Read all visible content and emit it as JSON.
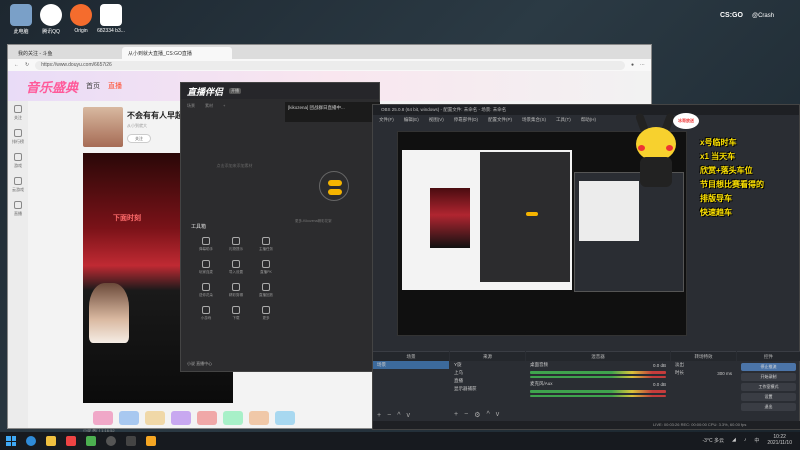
{
  "desktop": {
    "icons": [
      {
        "label": "此电脑",
        "color": "#7aa0c8"
      },
      {
        "label": "腾讯QQ",
        "color": "#ffffff"
      },
      {
        "label": "Origin",
        "color": "#f56c2d"
      },
      {
        "label": "682334 b3...",
        "color": "#ffffff"
      }
    ],
    "csgo_logo": "CS:GO",
    "weibo_handle": "@Crash"
  },
  "browser": {
    "tabs": [
      {
        "label": "我的关注 - 斗鱼",
        "active": false
      },
      {
        "label": "从小到就大直播_CS:GO直播",
        "active": true
      }
    ],
    "url": "https://www.douyu.com/6657i26",
    "site_logo": "音乐盛典",
    "nav": [
      "首页",
      "直播"
    ],
    "room_title": "不会有有人早起",
    "room_sub": "从小到就大",
    "follow_label": "关注",
    "video_caption": "下面时刻",
    "sidebar": [
      "关注",
      "排行榜",
      "游戏",
      "云游戏",
      "直播",
      "视频"
    ],
    "bottom_text": "小说 热门 1:16:52"
  },
  "castapp": {
    "brand": "直播伴侣",
    "version": "开播",
    "tabs": [
      "场景",
      "素材",
      "+"
    ],
    "empty_hint": "点击添加来添加素材",
    "toolbox_title": "工具箱",
    "tools": [
      "弹幕助手",
      "礼物提示",
      "主播任务",
      "玩家连麦",
      "导入设置",
      "直播PK",
      "送你花朵",
      "精彩剪辑",
      "直播回放",
      "小游戏",
      "下载",
      "更多"
    ],
    "hint": "更多-Kikozena精彩花絮",
    "footer": "小说 直播中心",
    "chat_title": "[kikozena] 团战群日直播中..."
  },
  "obs": {
    "title": "OBS 25.0.8 (64 bit, windows) - 配置文件: 未命名 - 场景: 未命名",
    "menu": [
      "文件(F)",
      "编辑(E)",
      "视图(V)",
      "停靠部件(D)",
      "配置文件(P)",
      "场景集合(S)",
      "工具(T)",
      "帮助(H)"
    ],
    "bubble": "冰哥放送",
    "docks": {
      "scenes": {
        "title": "场景",
        "items": [
          "场景"
        ]
      },
      "sources": {
        "title": "来源",
        "items": [
          "Y旋",
          "上乌",
          "直播",
          "显示器捕获"
        ]
      },
      "mixer": {
        "title": "混音器",
        "channels": [
          {
            "name": "桌面音频",
            "db": "0.0 dB"
          },
          {
            "name": "麦克风/Aux",
            "db": "0.0 dB"
          }
        ]
      },
      "transitions": {
        "title": "转场特效",
        "type": "淡出",
        "duration_label": "时长",
        "duration": "300 ms"
      },
      "controls": {
        "title": "控件",
        "buttons": [
          "停止推流",
          "开始录制",
          "工作室模式",
          "设置",
          "退出"
        ]
      }
    },
    "status": "LIVE: 00:03:26   REC: 00:00:00   CPU: 3.3%, 60.00 fps"
  },
  "promo": [
    "x号临时车",
    "x1 当天车",
    "欣赏+落头车位",
    "节目想比赛看得的",
    "排版导车",
    "快速趋车"
  ],
  "taskbar": {
    "weather": "-3°C 多云",
    "time": "10:22",
    "date": "2021/11/10",
    "language": "中"
  }
}
